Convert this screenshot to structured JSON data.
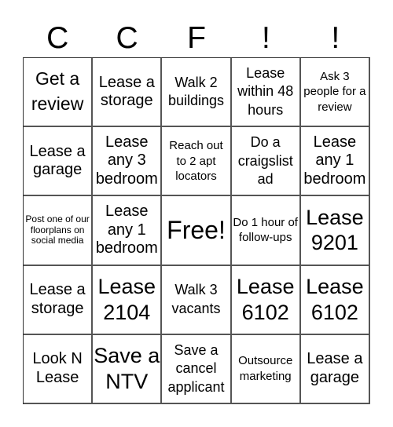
{
  "header": {
    "letters": [
      "C",
      "C",
      "F",
      "!",
      "!"
    ]
  },
  "grid": {
    "rows": [
      [
        "Get a review",
        "Lease a storage",
        "Walk 2 buildings",
        "Lease within 48 hours",
        "Ask 3 people for a review"
      ],
      [
        "Lease a garage",
        "Lease any 3 bedroom",
        "Reach out to 2 apt locators",
        "Do a craigslist ad",
        "Lease any 1 bedroom"
      ],
      [
        "Post one of our floorplans on social media",
        "Lease any 1 bedroom",
        "Free!",
        "Do 1 hour of follow-ups",
        "Lease 9201"
      ],
      [
        "Lease a storage",
        "Lease 2104",
        "Walk 3 vacants",
        "Lease 6102",
        "Lease 6102"
      ],
      [
        "Look N Lease",
        "Save a NTV",
        "Save a cancel applicant",
        "Outsource marketing",
        "Lease a garage"
      ]
    ]
  },
  "colors": {
    "text": "#000000",
    "border": "#555555",
    "background": "#ffffff"
  }
}
